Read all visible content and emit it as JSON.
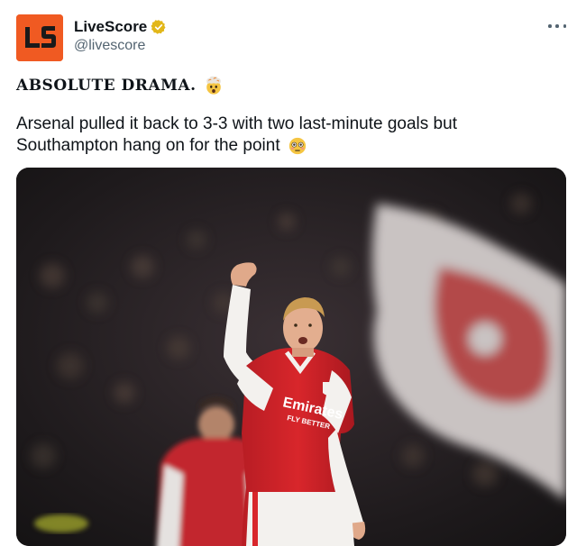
{
  "account": {
    "display_name": "LiveScore",
    "handle": "@livescore",
    "avatar_text": "LS",
    "verified": true,
    "brand_color": "#f05a22",
    "verified_color": "#e2b719"
  },
  "tweet": {
    "headline": "ABSOLUTE DRAMA.",
    "headline_emoji": "exploding-head-emoji",
    "body_line1": "Arsenal pulled it back to 3-3 with two last-minute goals but",
    "body_line2": "Southampton hang on for the point",
    "body_emoji": "flushed-face-emoji"
  },
  "media": {
    "shirt_sponsor": "Emirates",
    "shirt_tagline": "FLY BETTER",
    "description_icon": "photo"
  },
  "colors": {
    "text": "#0f1419",
    "muted": "#536471",
    "arsenal_red": "#d8262b"
  }
}
